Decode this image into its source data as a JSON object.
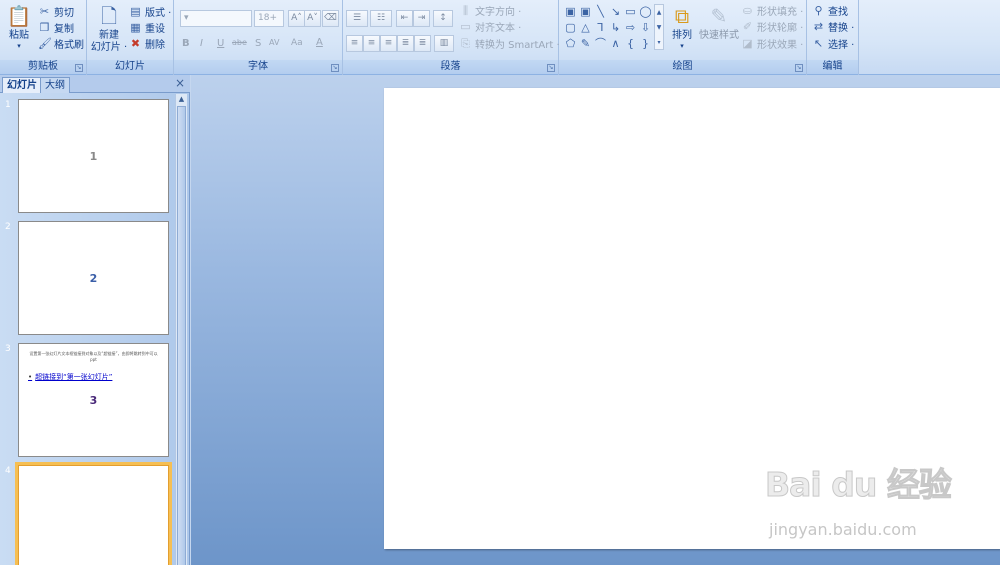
{
  "ribbon": {
    "clipboard": {
      "label": "剪贴板",
      "paste": "粘贴",
      "cut": "剪切",
      "copy": "复制",
      "format_painter": "格式刷"
    },
    "slides": {
      "label": "幻灯片",
      "new_slide_line1": "新建",
      "new_slide_line2": "幻灯片 ·",
      "layout": "版式 ·",
      "reset": "重设",
      "delete": "删除"
    },
    "font": {
      "label": "字体",
      "size": "18+",
      "grow": "A˄",
      "shrink": "A˅",
      "bold": "B",
      "italic": "I",
      "underline": "U",
      "strike": "abe",
      "shadow": "S",
      "spacing": "AV",
      "case": "Aa",
      "color": "A"
    },
    "paragraph": {
      "label": "段落",
      "text_direction": "文字方向 ·",
      "align_text": "对齐文本 ·",
      "convert_smartart": "转换为 SmartArt ·"
    },
    "drawing": {
      "label": "绘图",
      "arrange": "排列",
      "quick_styles": "快速样式",
      "shape_fill": "形状填充 ·",
      "shape_outline": "形状轮廓 ·",
      "shape_effects": "形状效果 ·"
    },
    "editing": {
      "label": "编辑",
      "find": "查找",
      "replace": "替换 ·",
      "select": "选择 ·"
    }
  },
  "panel": {
    "tab_slides": "幻灯片",
    "tab_outline": "大纲",
    "close": "×",
    "slides": [
      {
        "number": "1",
        "label": "1",
        "color": "#888888"
      },
      {
        "number": "2",
        "label": "2",
        "color": "#3b5fa8"
      },
      {
        "number": "3",
        "label": "3",
        "color": "#4a2a7a",
        "text": "设置第一张幻灯片文本框链接到对象以及“超链接”，由即将跳转到中可以",
        "sub": "ppt",
        "link": "超链接到“第一张幻灯片”"
      },
      {
        "number": "4",
        "label": "",
        "color": "#000000"
      }
    ]
  },
  "watermark": {
    "logo": "Bai du 经验",
    "url": "jingyan.baidu.com"
  }
}
